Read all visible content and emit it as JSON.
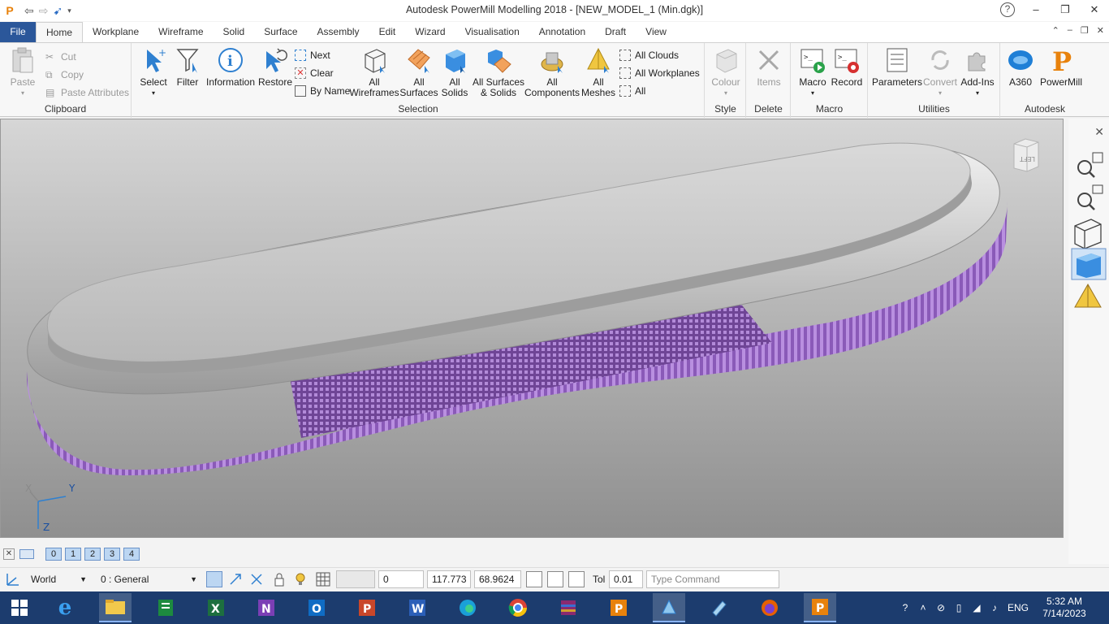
{
  "window": {
    "title": "Autodesk PowerMill Modelling 2018 - [NEW_MODEL_1 (Min.dgk)]",
    "app_icon": "P",
    "help": "?",
    "minimize": "–",
    "restore": "❐",
    "close": "✕"
  },
  "tabs": [
    "File",
    "Home",
    "Workplane",
    "Wireframe",
    "Solid",
    "Surface",
    "Assembly",
    "Edit",
    "Wizard",
    "Visualisation",
    "Annotation",
    "Draft",
    "View"
  ],
  "ribbon": {
    "clipboard": {
      "label": "Clipboard",
      "paste": "Paste",
      "cut": "Cut",
      "copy": "Copy",
      "paste_attributes": "Paste Attributes"
    },
    "selection": {
      "label": "Selection",
      "select": "Select",
      "filter": "Filter",
      "information": "Information",
      "restore": "Restore",
      "next": "Next",
      "clear": "Clear",
      "by_name": "By Name",
      "all_wireframes_1": "All",
      "all_wireframes_2": "Wireframes",
      "all_surfaces_1": "All",
      "all_surfaces_2": "Surfaces",
      "all_solids_1": "All",
      "all_solids_2": "Solids",
      "all_surfaces_solids_1": "All Surfaces",
      "all_surfaces_solids_2": "& Solids",
      "all_components_1": "All",
      "all_components_2": "Components",
      "all_meshes_1": "All",
      "all_meshes_2": "Meshes",
      "all_clouds": "All Clouds",
      "all_workplanes": "All Workplanes",
      "all": "All"
    },
    "style": {
      "label": "Style",
      "colour": "Colour"
    },
    "delete": {
      "label": "Delete",
      "items": "Items"
    },
    "macro": {
      "label": "Macro",
      "macro": "Macro",
      "record": "Record"
    },
    "utilities": {
      "label": "Utilities",
      "parameters": "Parameters",
      "convert": "Convert",
      "add_ins": "Add-Ins"
    },
    "autodesk": {
      "label": "Autodesk",
      "a360": "A360",
      "powermill": "PowerMill"
    }
  },
  "viewport": {
    "view_cube_label": "LEFT",
    "axis_x": "X",
    "axis_y": "Y",
    "axis_z": "Z"
  },
  "layers": [
    "0",
    "1",
    "2",
    "3",
    "4"
  ],
  "status": {
    "workplane": "World",
    "level": "0  : General",
    "field_blank": "",
    "value_0": "0",
    "value_x": "117.773",
    "value_y": "68.9624",
    "tol_label": "Tol",
    "tol_value": "0.01",
    "command_placeholder": "Type Command"
  },
  "taskbar": {
    "lang": "ENG",
    "time": "5:32 AM",
    "date": "7/14/2023"
  },
  "colors": {
    "accent": "#2b579a",
    "taskbar": "#1c3c6e",
    "mesh_purple": "#9b6bc4"
  }
}
